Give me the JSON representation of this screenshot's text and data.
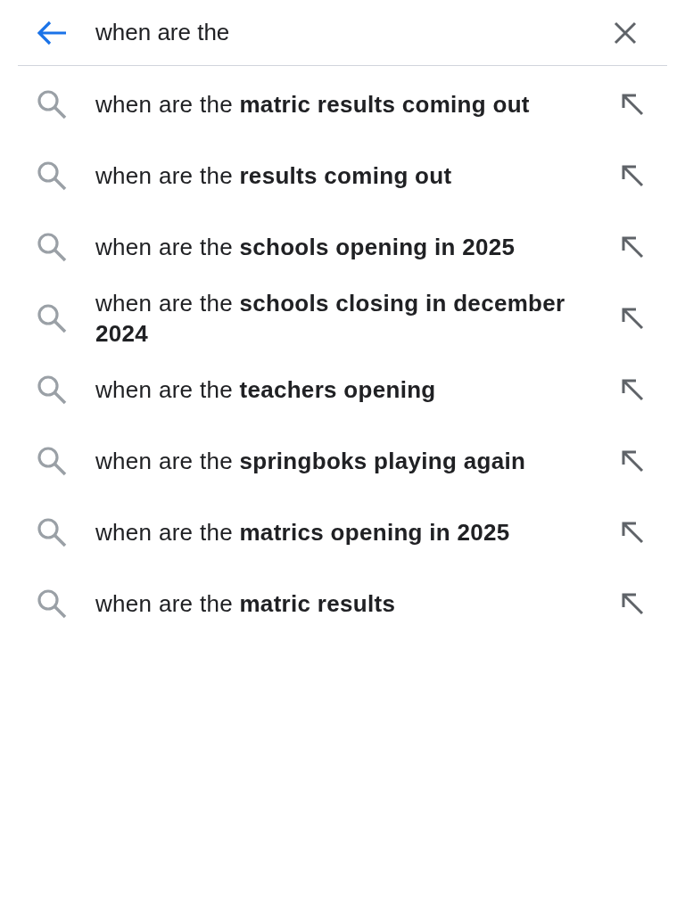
{
  "search_bar": {
    "query": "when are the"
  },
  "suggestions": [
    {
      "text": "when are the **matric results coming out**"
    },
    {
      "text": "when are the **results coming out**"
    },
    {
      "text": "when are the **schools opening in 2025**"
    },
    {
      "text": "when are the **schools closing in december 2024**"
    },
    {
      "text": "when are the **teachers opening**"
    },
    {
      "text": "when are the **springboks playing again**"
    },
    {
      "text": "when are the **matrics opening in 2025**"
    },
    {
      "text": "when are the **matric results**"
    }
  ]
}
